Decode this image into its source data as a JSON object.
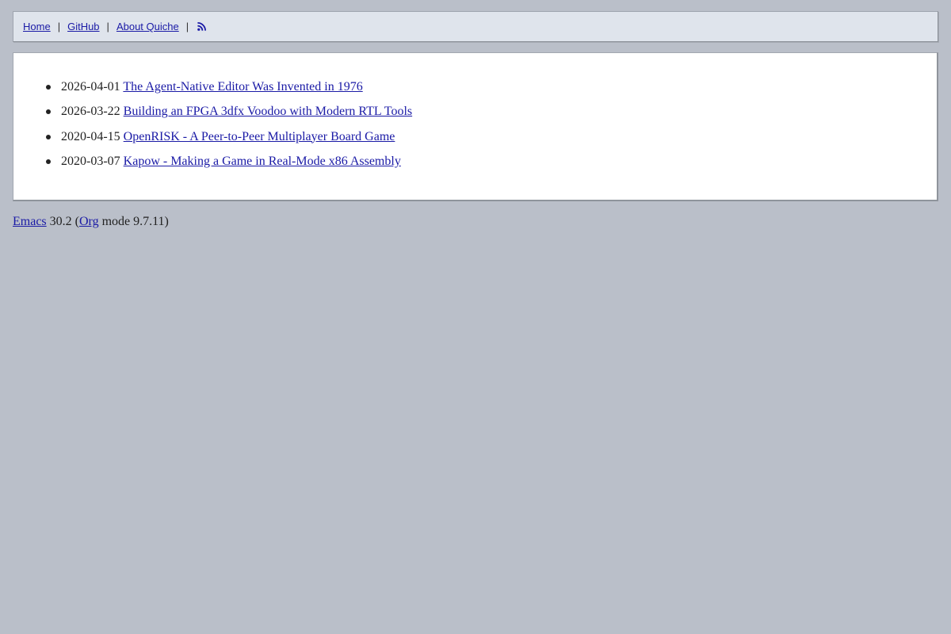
{
  "nav": {
    "home_label": "Home",
    "github_label": "GitHub",
    "about_label": "About Quiche",
    "separator": "|",
    "rss_icon": "rss-feed-icon"
  },
  "posts": [
    {
      "date": "2026-04-01",
      "title": "The Agent-Native Editor Was Invented in 1976"
    },
    {
      "date": "2026-03-22",
      "title": "Building an FPGA 3dfx Voodoo with Modern RTL Tools"
    },
    {
      "date": "2020-04-15",
      "title": "OpenRISK - A Peer-to-Peer Multiplayer Board Game"
    },
    {
      "date": "2020-03-07",
      "title": "Kapow - Making a Game in Real-Mode x86 Assembly"
    }
  ],
  "footer": {
    "emacs_label": "Emacs",
    "version_text": " 30.2 (",
    "org_label": "Org",
    "mode_text": " mode 9.7.11)"
  },
  "colors": {
    "background": "#babfc9",
    "nav_background": "#dfe4ec",
    "link": "#1a1aa6",
    "content_background": "#ffffff"
  }
}
